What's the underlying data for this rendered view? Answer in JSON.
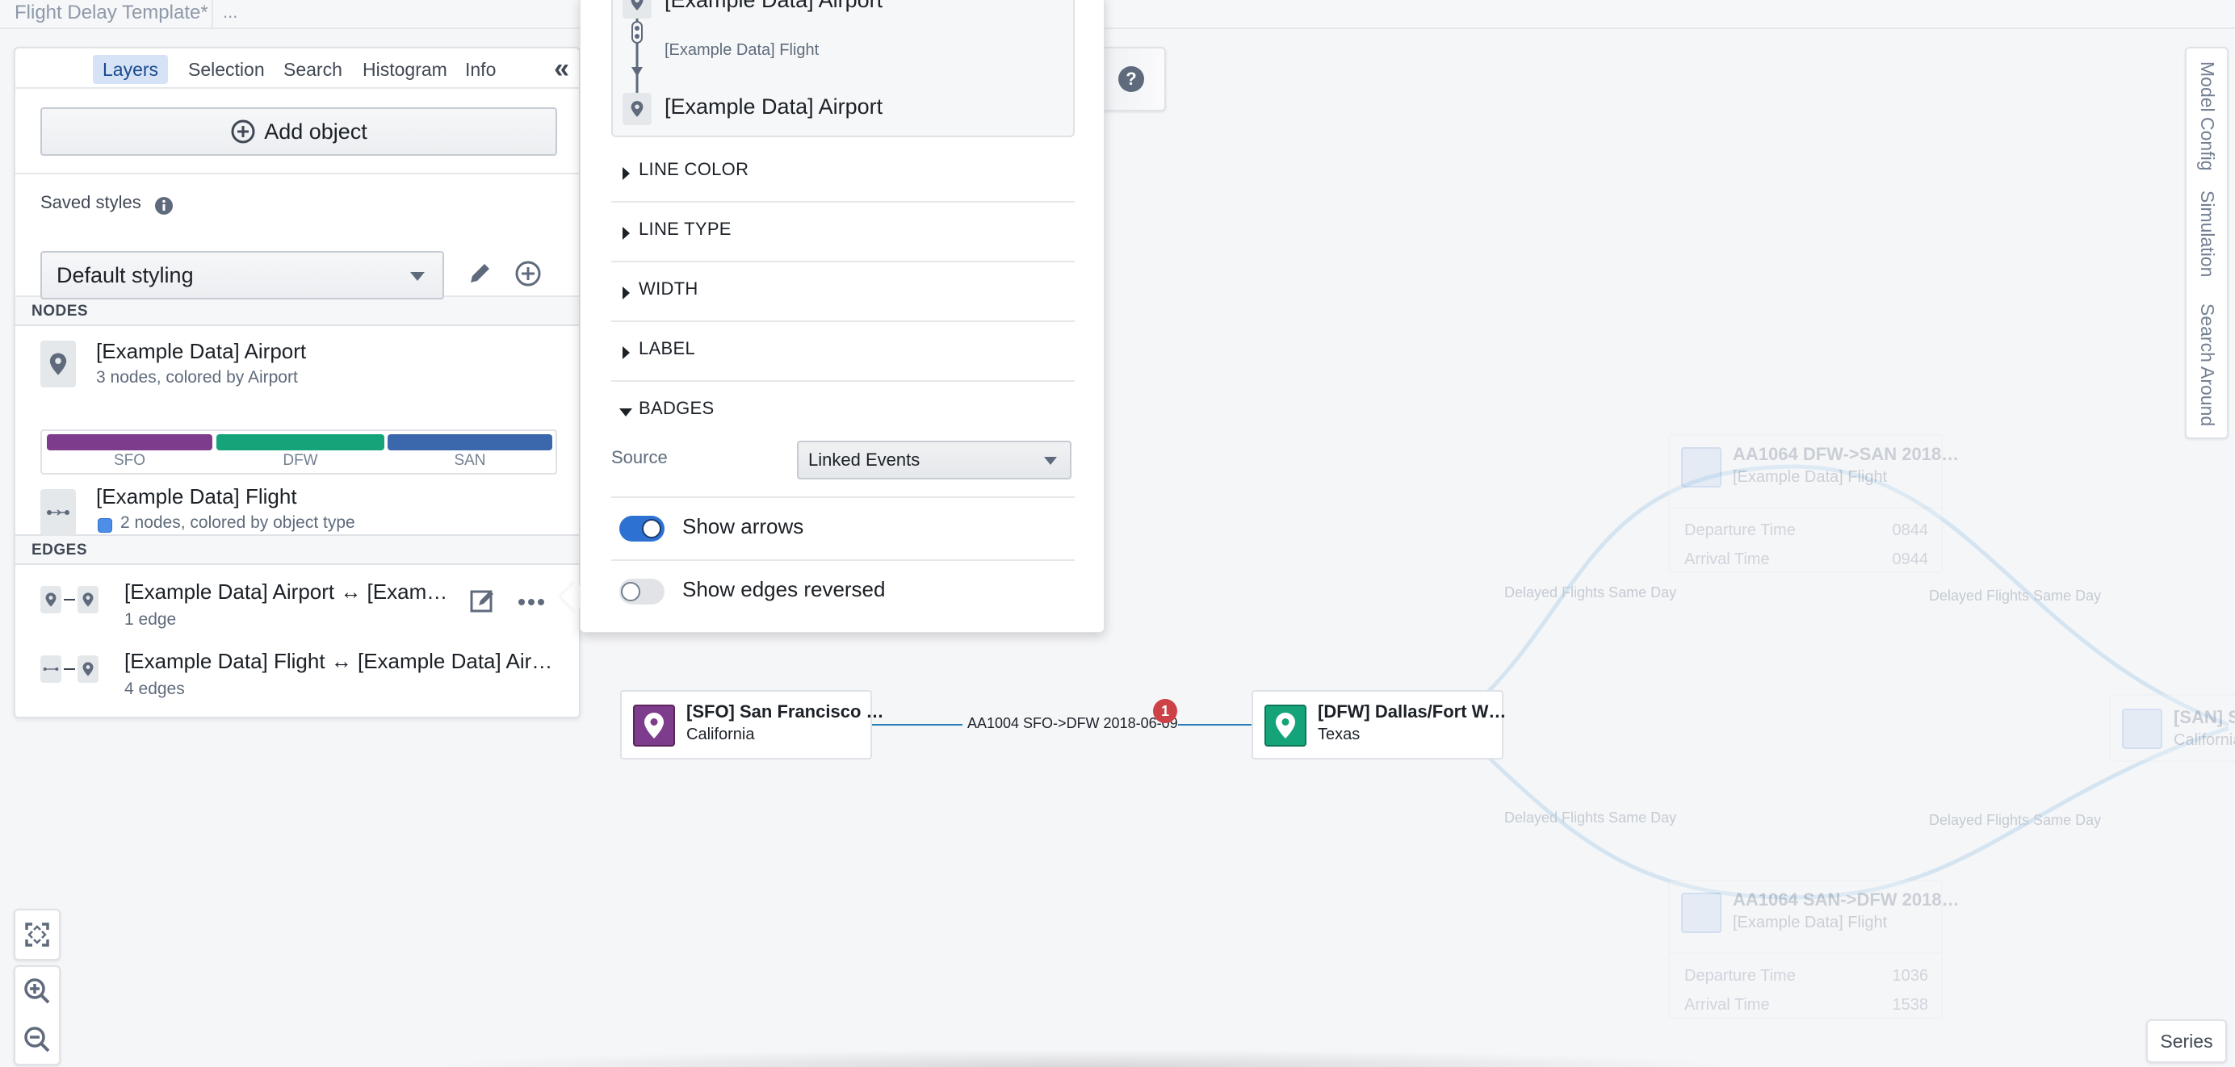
{
  "topbar": {
    "title": "Flight Delay Template*",
    "more": "..."
  },
  "left_panel": {
    "tabs": [
      {
        "label": "Layers",
        "active": true
      },
      {
        "label": "Selection",
        "active": false
      },
      {
        "label": "Search",
        "active": false
      },
      {
        "label": "Histogram",
        "active": false
      },
      {
        "label": "Info",
        "active": false
      }
    ],
    "collapse_icon": "double-chevron-left-icon",
    "add_object_label": "Add object",
    "saved_styles": {
      "label": "Saved styles",
      "selected": "Default styling"
    },
    "nodes_header": "NODES",
    "node_layers": [
      {
        "title": "[Example Data] Airport",
        "subtitle": "3 nodes, colored by Airport",
        "icon": "map-marker-icon",
        "legend": [
          {
            "label": "SFO",
            "color": "#7e3c8d"
          },
          {
            "label": "DFW",
            "color": "#15a47a"
          },
          {
            "label": "SAN",
            "color": "#3b68ad"
          }
        ]
      },
      {
        "title": "[Example Data] Flight",
        "subtitle": "2 nodes, colored by object type",
        "icon": "flight-link-icon",
        "swatch_color": "#4c8ee8"
      }
    ],
    "edges_header": "EDGES",
    "edge_layers": [
      {
        "title": "[Example Data] Airport ↔ [Exam…",
        "subtitle": "1 edge"
      },
      {
        "title": "[Example Data] Flight ↔ [Example Data] Air…",
        "subtitle": "4 edges"
      }
    ]
  },
  "popover": {
    "path": {
      "top": "[Example Data] Airport",
      "middle": "[Example Data] Flight",
      "bottom": "[Example Data] Airport"
    },
    "sections": [
      {
        "label": "LINE COLOR",
        "expanded": false
      },
      {
        "label": "LINE TYPE",
        "expanded": false
      },
      {
        "label": "WIDTH",
        "expanded": false
      },
      {
        "label": "LABEL",
        "expanded": false
      },
      {
        "label": "BADGES",
        "expanded": true
      }
    ],
    "badges": {
      "source_label": "Source",
      "source_value": "Linked Events"
    },
    "toggles": [
      {
        "label": "Show arrows",
        "on": true
      },
      {
        "label": "Show edges reversed",
        "on": false
      }
    ]
  },
  "right_tabs": [
    "Model Config",
    "Simulation",
    "Search Around"
  ],
  "graph": {
    "nodes": [
      {
        "id": "sfo",
        "title": "[SFO] San Francisco …",
        "subtitle": "California",
        "color": "#7e3c8d"
      },
      {
        "id": "dfw",
        "title": "[DFW] Dallas/Fort W…",
        "subtitle": "Texas",
        "color": "#15a47a"
      },
      {
        "id": "san",
        "title": "[SAN] San",
        "subtitle": "California",
        "color": "#b9cfee"
      }
    ],
    "main_edge": {
      "label": "AA1004 SFO->DFW 2018-06-09",
      "badge_count": "1",
      "color": "#2b7fb8"
    },
    "faded_flights": [
      {
        "title": "AA1064 DFW->SAN 2018…",
        "subtitle": "[Example Data] Flight",
        "props": [
          {
            "name": "Departure Time",
            "value": "0844"
          },
          {
            "name": "Arrival Time",
            "value": "0944"
          }
        ]
      },
      {
        "title": "AA1064 SAN->DFW 2018…",
        "subtitle": "[Example Data] Flight",
        "props": [
          {
            "name": "Departure Time",
            "value": "1036"
          },
          {
            "name": "Arrival Time",
            "value": "1538"
          }
        ]
      }
    ],
    "faded_edge_label": "Delayed Flights Same Day"
  },
  "controls": {
    "fit_icon": "fit-to-screen-icon",
    "zoom_in_icon": "zoom-in-icon",
    "zoom_out_icon": "zoom-out-icon",
    "series_label": "Series"
  },
  "help_icon": "help-icon"
}
